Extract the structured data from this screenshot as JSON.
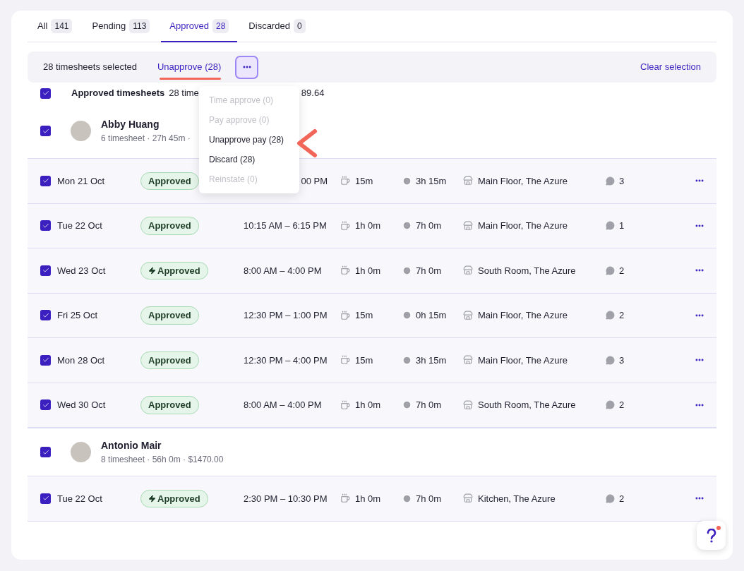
{
  "tabs": [
    {
      "label": "All",
      "count": "141",
      "selected": false
    },
    {
      "label": "Pending",
      "count": "113",
      "selected": false
    },
    {
      "label": "Approved",
      "count": "28",
      "selected": true
    },
    {
      "label": "Discarded",
      "count": "0",
      "selected": false
    }
  ],
  "toolbar": {
    "selected_text": "28 timesheets selected",
    "unapprove_label": "Unapprove (28)",
    "clear_label": "Clear selection",
    "more_menu": {
      "expanded": true,
      "items": [
        {
          "label": "Time approve (0)",
          "disabled": true
        },
        {
          "label": "Pay approve (0)",
          "disabled": true
        },
        {
          "label": "Unapprove pay (28)",
          "disabled": false
        },
        {
          "label": "Discard (28)",
          "disabled": false
        },
        {
          "label": "Reinstate (0)",
          "disabled": true
        }
      ]
    }
  },
  "summary": {
    "checked": true,
    "title": "Approved timesheets",
    "text_start": "28 time",
    "text_end": "89.64"
  },
  "groups": [
    {
      "name": "Abby Huang",
      "meta": "6 timesheet · 27h 45m ·",
      "checked": true,
      "rows": [
        {
          "checked": true,
          "date": "Mon 21 Oct",
          "status": "Approved",
          "instant": false,
          "time": "00 PM",
          "time_partial": true,
          "break": "15m",
          "duration": "3h 15m",
          "location": "Main Floor, The Azure",
          "comments": "3"
        },
        {
          "checked": true,
          "date": "Tue 22 Oct",
          "status": "Approved",
          "instant": false,
          "time": "10:15 AM – 6:15 PM",
          "break": "1h 0m",
          "duration": "7h 0m",
          "location": "Main Floor, The Azure",
          "comments": "1"
        },
        {
          "checked": true,
          "date": "Wed 23 Oct",
          "status": "Approved",
          "instant": true,
          "time": "8:00 AM – 4:00 PM",
          "break": "1h 0m",
          "duration": "7h 0m",
          "location": "South Room, The Azure",
          "comments": "2"
        },
        {
          "checked": true,
          "date": "Fri 25 Oct",
          "status": "Approved",
          "instant": false,
          "time": "12:30 PM – 1:00 PM",
          "break": "15m",
          "duration": "0h 15m",
          "location": "Main Floor, The Azure",
          "comments": "2"
        },
        {
          "checked": true,
          "date": "Mon 28 Oct",
          "status": "Approved",
          "instant": false,
          "time": "12:30 PM – 4:00 PM",
          "break": "15m",
          "duration": "3h 15m",
          "location": "Main Floor, The Azure",
          "comments": "3"
        },
        {
          "checked": true,
          "date": "Wed 30 Oct",
          "status": "Approved",
          "instant": false,
          "time": "8:00 AM – 4:00 PM",
          "break": "1h 0m",
          "duration": "7h 0m",
          "location": "South Room, The Azure",
          "comments": "2"
        }
      ]
    },
    {
      "name": "Antonio Mair",
      "meta": "8 timesheet · 56h 0m · $1470.00",
      "checked": true,
      "rows": [
        {
          "checked": true,
          "date": "Tue 22 Oct",
          "status": "Approved",
          "instant": true,
          "time": "2:30 PM – 10:30 PM",
          "break": "1h 0m",
          "duration": "7h 0m",
          "location": "Kitchen, The Azure",
          "comments": "2"
        }
      ]
    }
  ],
  "help": {
    "has_notification": true
  }
}
